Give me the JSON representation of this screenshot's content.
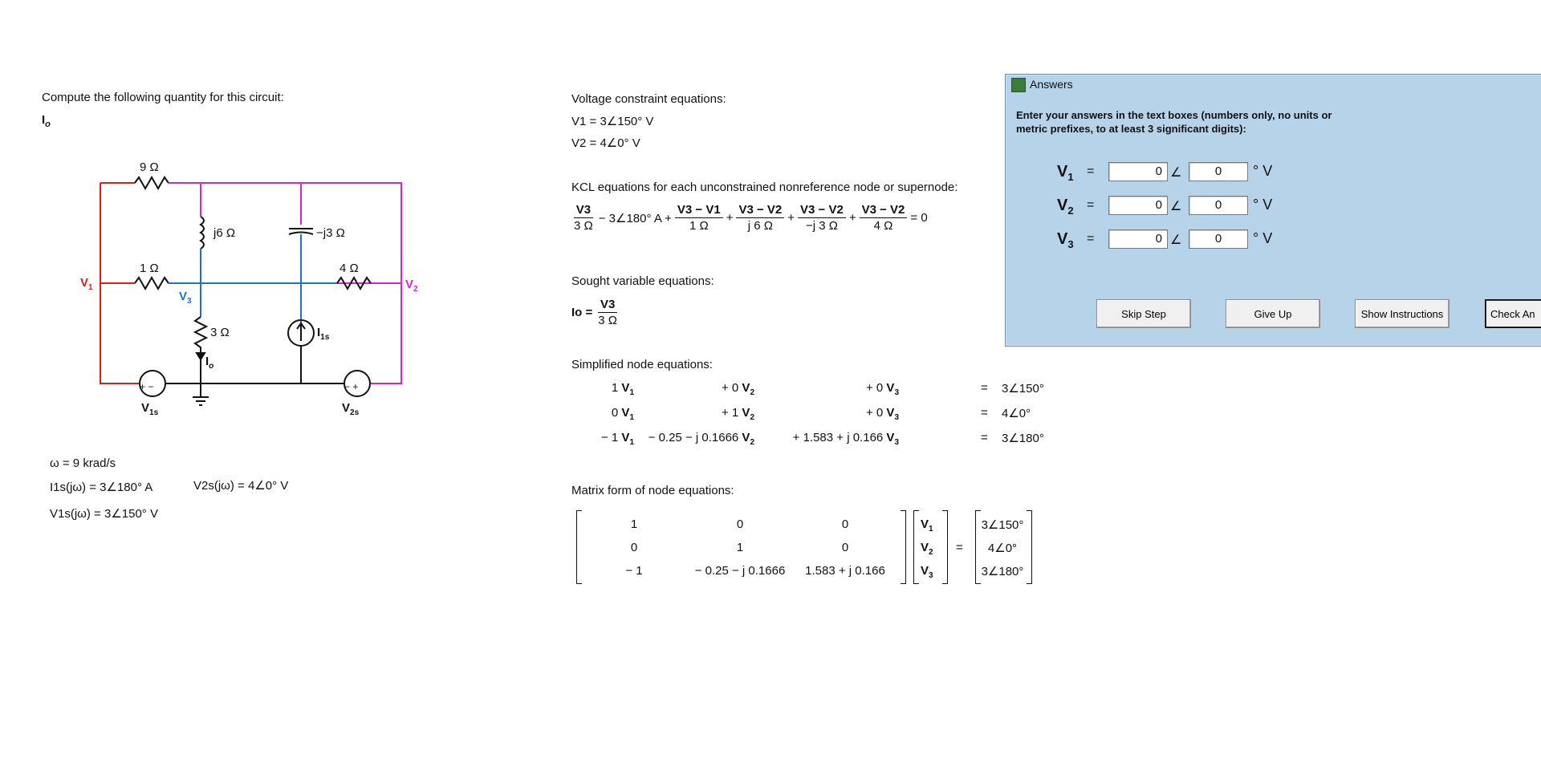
{
  "problem": {
    "prompt": "Compute the following quantity for this circuit:",
    "quantity": "I",
    "quantity_sub": "o"
  },
  "circuit": {
    "r_top": "9 Ω",
    "l1": "j6 Ω",
    "c1": "−j3 Ω",
    "r_mid_left": "1 Ω",
    "r_mid_right": "4 Ω",
    "r_bottom": "3 Ω",
    "v1_label": "V",
    "v1_sub": "1",
    "v2_label": "V",
    "v2_sub": "2",
    "v3_label": "V",
    "v3_sub": "3",
    "i1s_label": "I",
    "i1s_sub": "1s",
    "io_label": "I",
    "io_sub": "o",
    "v1s_label": "V",
    "v1s_sub": "1s",
    "v2s_label": "V",
    "v2s_sub": "2s",
    "colors": {
      "v1": "#e01b1b",
      "v2": "#e020d0",
      "v3": "#1f6fd0",
      "ground": "#111111"
    }
  },
  "givens": {
    "omega": "ω = 9 krad/s",
    "i1s": "I1s(jω) = 3∠180° A",
    "v2s": "V2s(jω) = 4∠0° V",
    "v1s": "V1s(jω) = 3∠150° V"
  },
  "steps": {
    "voltage_constraints_title": "Voltage constraint equations:",
    "vc1": "V1 = 3∠150° V",
    "vc2": "V2 = 4∠0° V",
    "kcl_title": "KCL equations for each unconstrained nonreference node or supernode:",
    "kcl": {
      "t1_num": "V3",
      "t1_den": "3 Ω",
      "t2": "− 3∠180° A +",
      "t3_num": "V3 − V1",
      "t3_den": "1 Ω",
      "t4_num": "V3 − V2",
      "t4_den": "j 6 Ω",
      "t5_num": "V3 − V2",
      "t5_den": "−j 3 Ω",
      "t6_num": "V3 − V2",
      "t6_den": "4 Ω",
      "plus": "+",
      "equals_zero": "= 0"
    },
    "sought_title": "Sought variable equations:",
    "sought": {
      "lhs": "Io =",
      "num": "V3",
      "den": "3 Ω"
    },
    "simplified_title": "Simplified node equations:",
    "simplified_rows": [
      {
        "c1": "1 V1",
        "c2": "+ 0 V2",
        "c3": "+ 0 V3",
        "eq": "=",
        "rhs": "3∠150°"
      },
      {
        "c1": "0 V1",
        "c2": "+ 1 V2",
        "c3": "+ 0 V3",
        "eq": "=",
        "rhs": "4∠0°"
      },
      {
        "c1": "− 1 V1",
        "c2": "−  0.25 − j 0.1666 V2",
        "c3": "+ 1.583 + j 0.166 V3",
        "eq": "=",
        "rhs": "3∠180°"
      }
    ],
    "matrix_title": "Matrix form of node equations:",
    "matrix_rows": [
      [
        "1",
        "0",
        "0"
      ],
      [
        "0",
        "1",
        "0"
      ],
      [
        "− 1",
        "− 0.25 − j 0.1666",
        "1.583 + j 0.166"
      ]
    ],
    "vector": [
      "V1",
      "V2",
      "V3"
    ],
    "matrix_eq": "=",
    "rhs": [
      "3∠150°",
      "4∠0°",
      "3∠180°"
    ]
  },
  "dialog": {
    "title": "Answers",
    "instructions": "Enter your answers in the text boxes (numbers only, no units or metric prefixes, to at least 3 significant digits):",
    "rows": [
      {
        "label": "V",
        "sub": "1",
        "eq": "=",
        "mag": "0",
        "angle": "0",
        "unit": "° V"
      },
      {
        "label": "V",
        "sub": "2",
        "eq": "=",
        "mag": "0",
        "angle": "0",
        "unit": "° V"
      },
      {
        "label": "V",
        "sub": "3",
        "eq": "=",
        "mag": "0",
        "angle": "0",
        "unit": "° V"
      }
    ],
    "angle_symbol": "∠",
    "buttons": {
      "skip": "Skip Step",
      "give_up": "Give Up",
      "show_instructions": "Show Instructions",
      "check": "Check An"
    }
  }
}
